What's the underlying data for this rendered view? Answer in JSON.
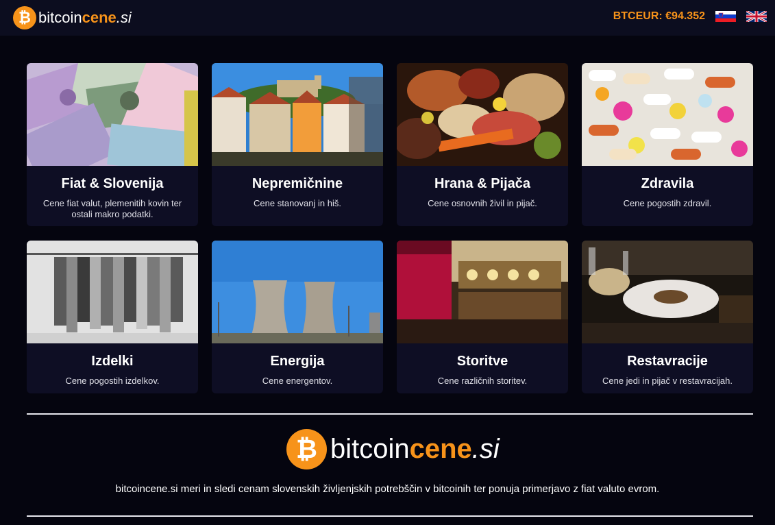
{
  "header": {
    "logo": {
      "symbol": "₿",
      "part1": "bitcoin",
      "part2": "cene",
      "part3": ".si"
    },
    "price": "BTCEUR: €94.352",
    "languages": [
      "Slovenščina",
      "English"
    ]
  },
  "categories": [
    {
      "title": "Fiat & Slovenija",
      "desc": "Cene fiat valut, plemenitih kovin ter ostali makro podatki."
    },
    {
      "title": "Nepremičnine",
      "desc": "Cene stanovanj in hiš."
    },
    {
      "title": "Hrana & Pijača",
      "desc": "Cene osnovnih živil in pijač."
    },
    {
      "title": "Zdravila",
      "desc": "Cene pogostih zdravil."
    },
    {
      "title": "Izdelki",
      "desc": "Cene pogostih izdelkov."
    },
    {
      "title": "Energija",
      "desc": "Cene energentov."
    },
    {
      "title": "Storitve",
      "desc": "Cene različnih storitev."
    },
    {
      "title": "Restavracije",
      "desc": "Cene jedi in pijač v restavracijah."
    }
  ],
  "footer": {
    "logo": {
      "symbol": "₿",
      "part1": "bitcoin",
      "part2": "cene",
      "part3": ".si"
    },
    "text": "bitcoincene.si meri in sledi cenam slovenskih življenjskih potrebščin v bitcoinih ter ponuja primerjavo z fiat valuto evrom."
  },
  "colors": {
    "accent": "#f7931a",
    "background": "#05050f",
    "card": "#0e0e24"
  }
}
